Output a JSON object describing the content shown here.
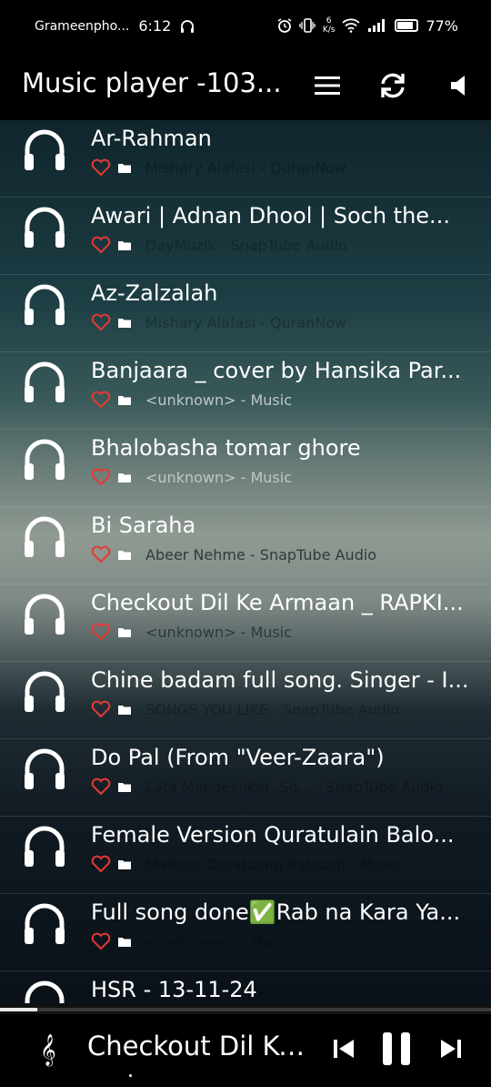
{
  "status_bar": {
    "carrier": "Grameenpho...",
    "time": "6:12",
    "network_speed_value": "6",
    "network_speed_unit": "K/s",
    "battery": "77%"
  },
  "app_bar": {
    "title": "Music player -103...",
    "icons": [
      "menu-icon",
      "sync-icon",
      "volume-icon"
    ]
  },
  "tracks": [
    {
      "title": "Ar-Rahman",
      "subtitle": "Mishary Alafasi - QuranNow"
    },
    {
      "title": "Awari | Adnan Dhool | Soch the...",
      "subtitle": "DayMuzik - SnapTube Audio"
    },
    {
      "title": "Az-Zalzalah",
      "subtitle": "Mishary Alafasi - QuranNow"
    },
    {
      "title": "Banjaara _ cover by Hansika Par...",
      "subtitle": "<unknown> - Music"
    },
    {
      "title": "Bhalobasha tomar ghore",
      "subtitle": "<unknown> - Music"
    },
    {
      "title": "Bi Saraha",
      "subtitle": "Abeer Nehme - SnapTube Audio"
    },
    {
      "title": "Checkout Dil Ke Armaan _ RAPKI...",
      "subtitle": "<unknown> - Music"
    },
    {
      "title": "Chine badam full song. Singer - I...",
      "subtitle": "SONGS YOU LIKE - SnapTube Audio"
    },
    {
      "title": "Do Pal (From \"Veer-Zaara\")",
      "subtitle": "Lata Mangeshkar, So... - SnapTube Audio"
    },
    {
      "title": "Female Version Quratulain Balo...",
      "subtitle": "Malkoo, Quratulain Balouch - Music"
    },
    {
      "title": "Full song done✅Rab na Kara Ya...",
      "subtitle": "<unknown> - Music"
    },
    {
      "title": "HSR - 13-11-24",
      "subtitle": ""
    }
  ],
  "player": {
    "now_playing": "Checkout Dil Ke...",
    "progress_fraction": 0.075,
    "icons": [
      "clef-icon",
      "previous-icon",
      "pause-icon",
      "next-icon"
    ]
  },
  "colors": {
    "heart": "#e53935",
    "bar_background": "#000000"
  }
}
